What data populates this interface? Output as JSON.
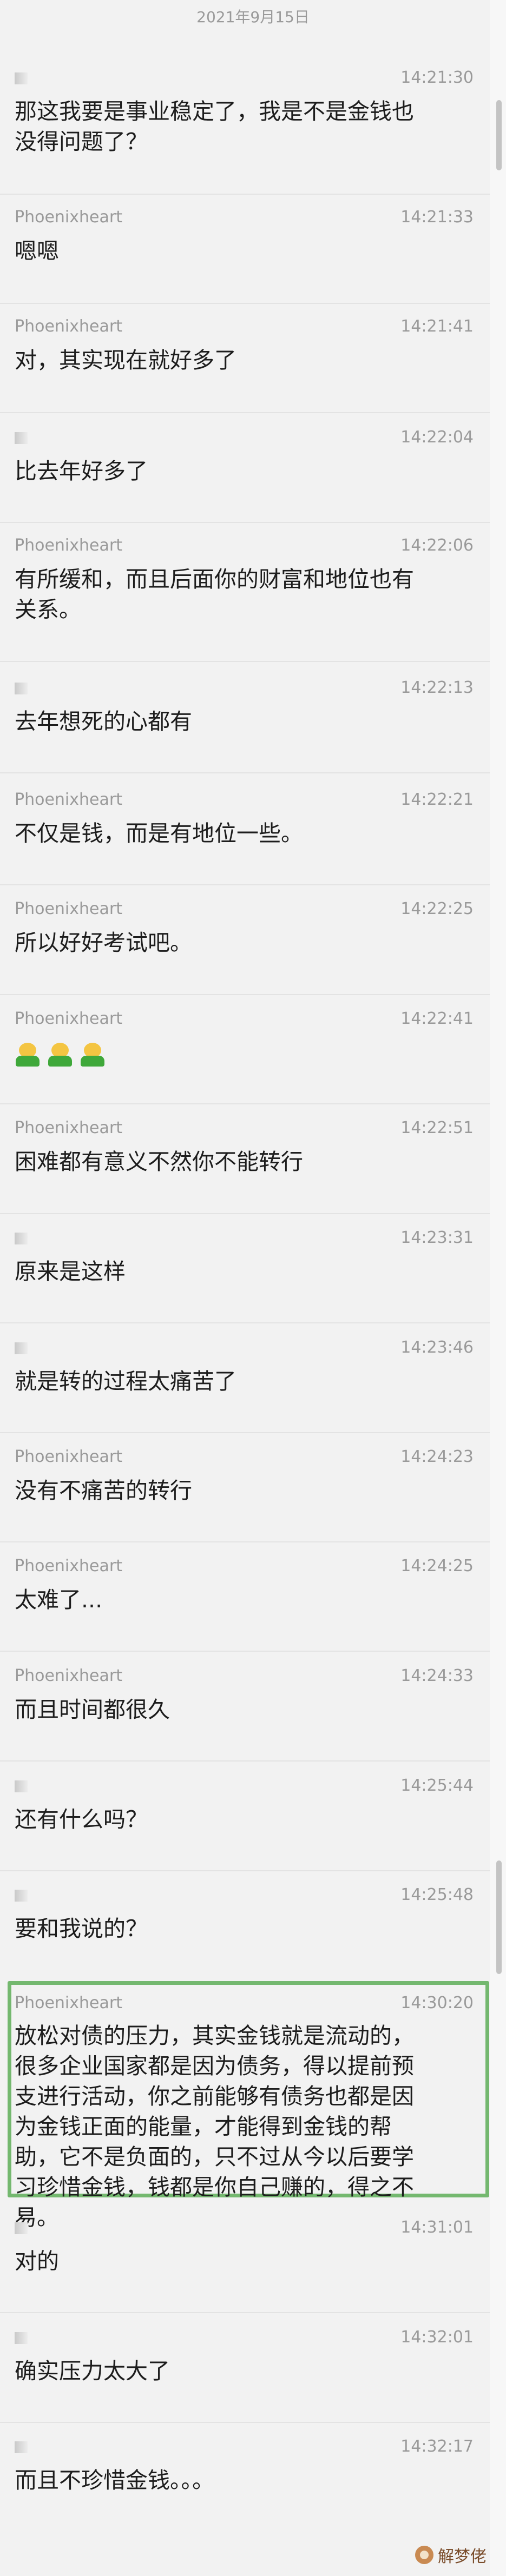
{
  "date_header": "2021年9月15日",
  "messages": [
    {
      "sender": "",
      "time": "14:21:30",
      "text": "那这我要是事业稳定了，我是不是金钱也\n没得问题了？"
    },
    {
      "sender": "Phoenixheart",
      "time": "14:21:33",
      "text": "嗯嗯"
    },
    {
      "sender": "Phoenixheart",
      "time": "14:21:41",
      "text": "对，其实现在就好多了"
    },
    {
      "sender": "",
      "time": "14:22:04",
      "text": "比去年好多了"
    },
    {
      "sender": "Phoenixheart",
      "time": "14:22:06",
      "text": "有所缓和，而且后面你的财富和地位也有\n关系。"
    },
    {
      "sender": "",
      "time": "14:22:13",
      "text": "去年想死的心都有"
    },
    {
      "sender": "Phoenixheart",
      "time": "14:22:21",
      "text": "不仅是钱，而是有地位一些。"
    },
    {
      "sender": "Phoenixheart",
      "time": "14:22:25",
      "text": "所以好好考试吧。"
    },
    {
      "sender": "Phoenixheart",
      "time": "14:22:41",
      "text": ""
    },
    {
      "sender": "Phoenixheart",
      "time": "14:22:51",
      "text": "困难都有意义不然你不能转行"
    },
    {
      "sender": "",
      "time": "14:23:31",
      "text": "原来是这样"
    },
    {
      "sender": "",
      "time": "14:23:46",
      "text": "就是转的过程太痛苦了"
    },
    {
      "sender": "Phoenixheart",
      "time": "14:24:23",
      "text": "没有不痛苦的转行"
    },
    {
      "sender": "Phoenixheart",
      "time": "14:24:25",
      "text": "太难了..."
    },
    {
      "sender": "Phoenixheart",
      "time": "14:24:33",
      "text": "而且时间都很久"
    },
    {
      "sender": "",
      "time": "14:25:44",
      "text": "还有什么吗？"
    },
    {
      "sender": "",
      "time": "14:25:48",
      "text": "要和我说的？"
    },
    {
      "sender": "Phoenixheart",
      "time": "14:30:20",
      "text": "放松对债的压力，其实金钱就是流动的，\n很多企业国家都是因为债务，得以提前预\n支进行活动，你之前能够有债务也都是因\n为金钱正面的能量，才能得到金钱的帮\n助，它不是负面的，只不过从今以后要学\n习珍惜金钱，钱都是你自己赚的，得之不\n易。"
    },
    {
      "sender": "",
      "time": "14:31:01",
      "text": "对的"
    },
    {
      "sender": "",
      "time": "14:32:01",
      "text": "确实压力太大了"
    },
    {
      "sender": "",
      "time": "14:32:17",
      "text": "而且不珍惜金钱。。。"
    }
  ],
  "emoji_count": 3,
  "watermark": "解梦佬",
  "colors": {
    "highlight_border": "#74b86f",
    "background": "#f2f2f2",
    "meta_text": "#9a9a9a"
  }
}
